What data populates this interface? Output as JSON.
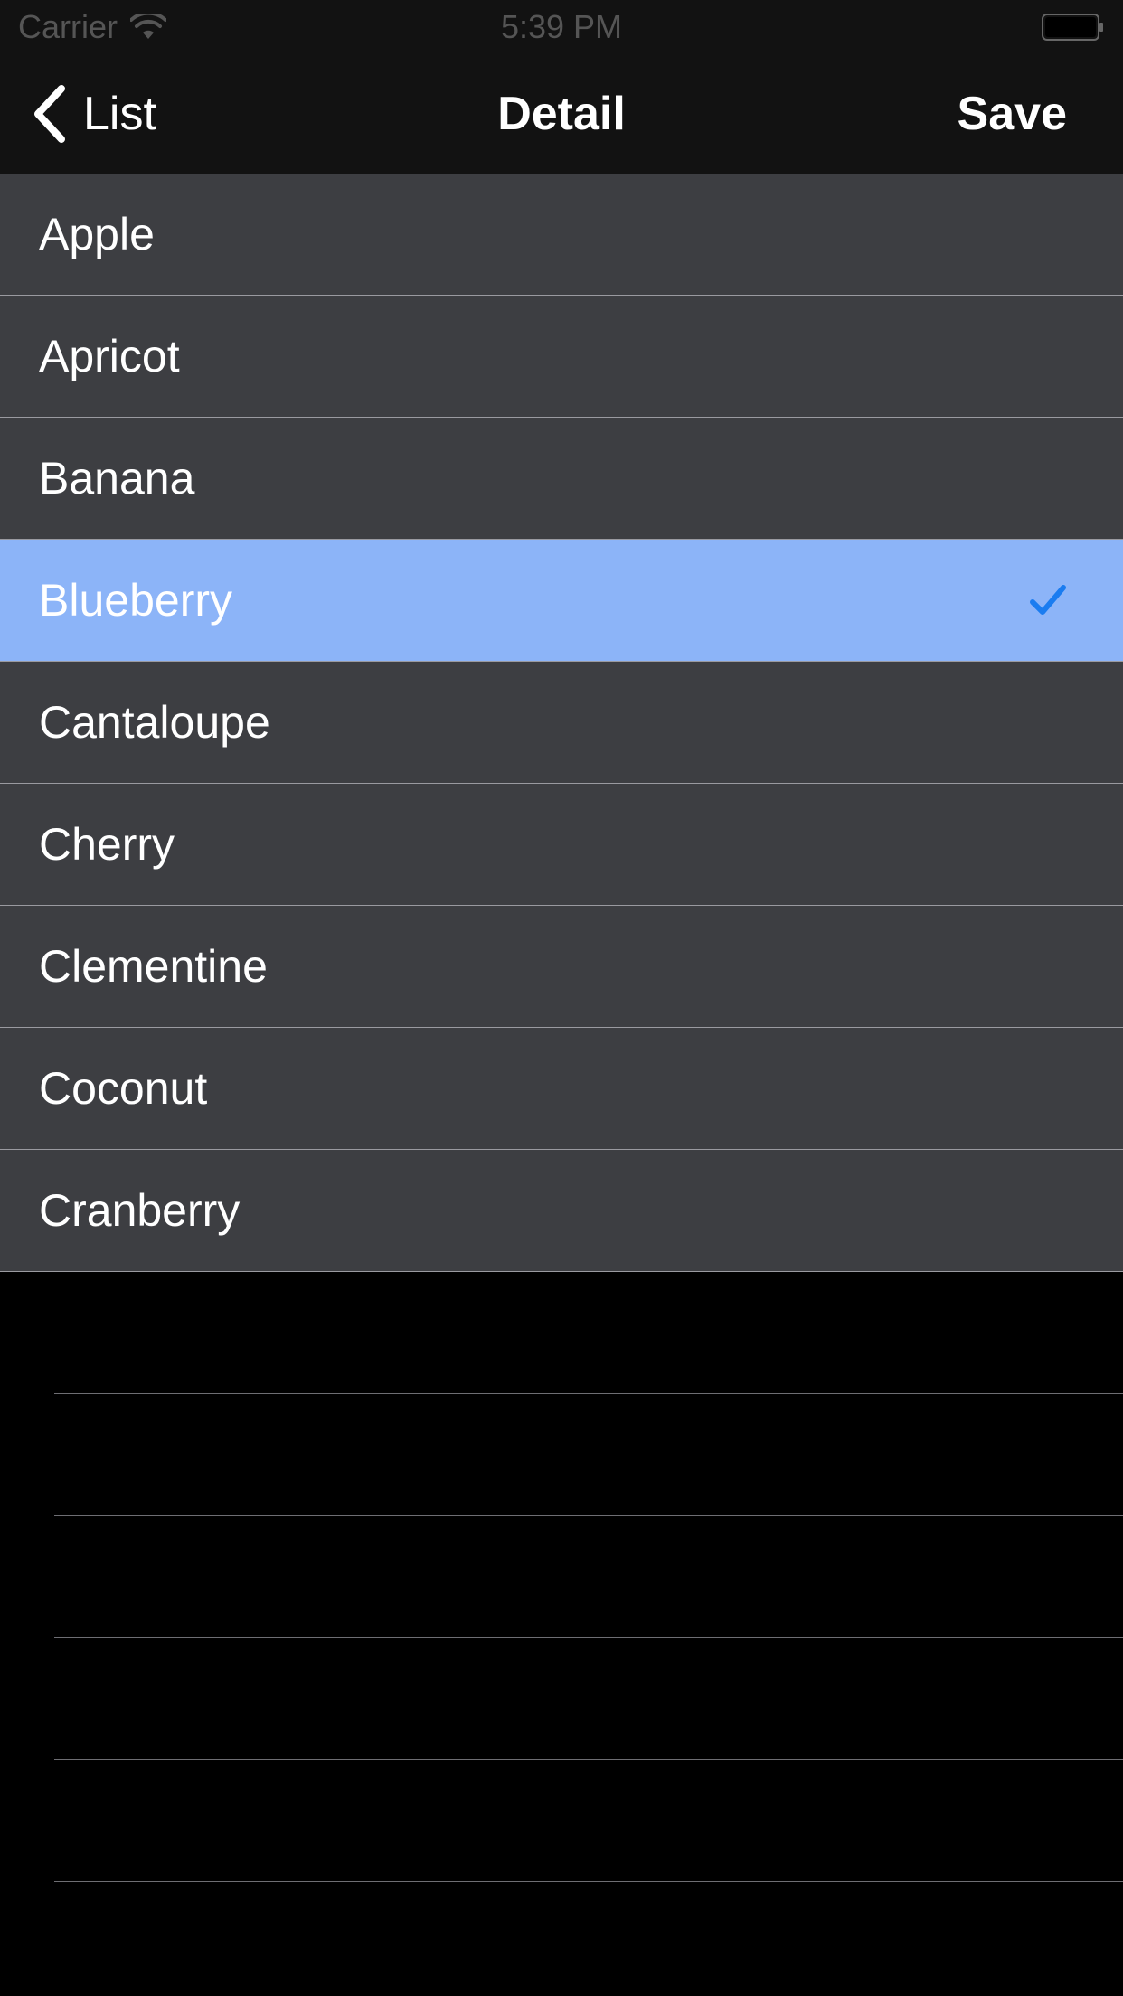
{
  "status_bar": {
    "carrier": "Carrier",
    "time": "5:39 PM",
    "wifi_icon": "wifi-icon",
    "battery_icon": "battery-icon"
  },
  "nav": {
    "back_label": "List",
    "back_icon": "chevron-left-icon",
    "title": "Detail",
    "save_label": "Save"
  },
  "list": {
    "items": [
      {
        "label": "Apple",
        "selected": false
      },
      {
        "label": "Apricot",
        "selected": false
      },
      {
        "label": "Banana",
        "selected": false
      },
      {
        "label": "Blueberry",
        "selected": true
      },
      {
        "label": "Cantaloupe",
        "selected": false
      },
      {
        "label": "Cherry",
        "selected": false
      },
      {
        "label": "Clementine",
        "selected": false
      },
      {
        "label": "Coconut",
        "selected": false
      },
      {
        "label": "Cranberry",
        "selected": false
      }
    ],
    "selected_icon": "checkmark-icon"
  },
  "colors": {
    "background": "#000000",
    "bar_background": "#121212",
    "row_background": "#3d3e42",
    "selected_row": "#8cb4f8",
    "checkmark": "#1a7cf0",
    "separator": "#9a9aa0",
    "text": "#ffffff"
  }
}
